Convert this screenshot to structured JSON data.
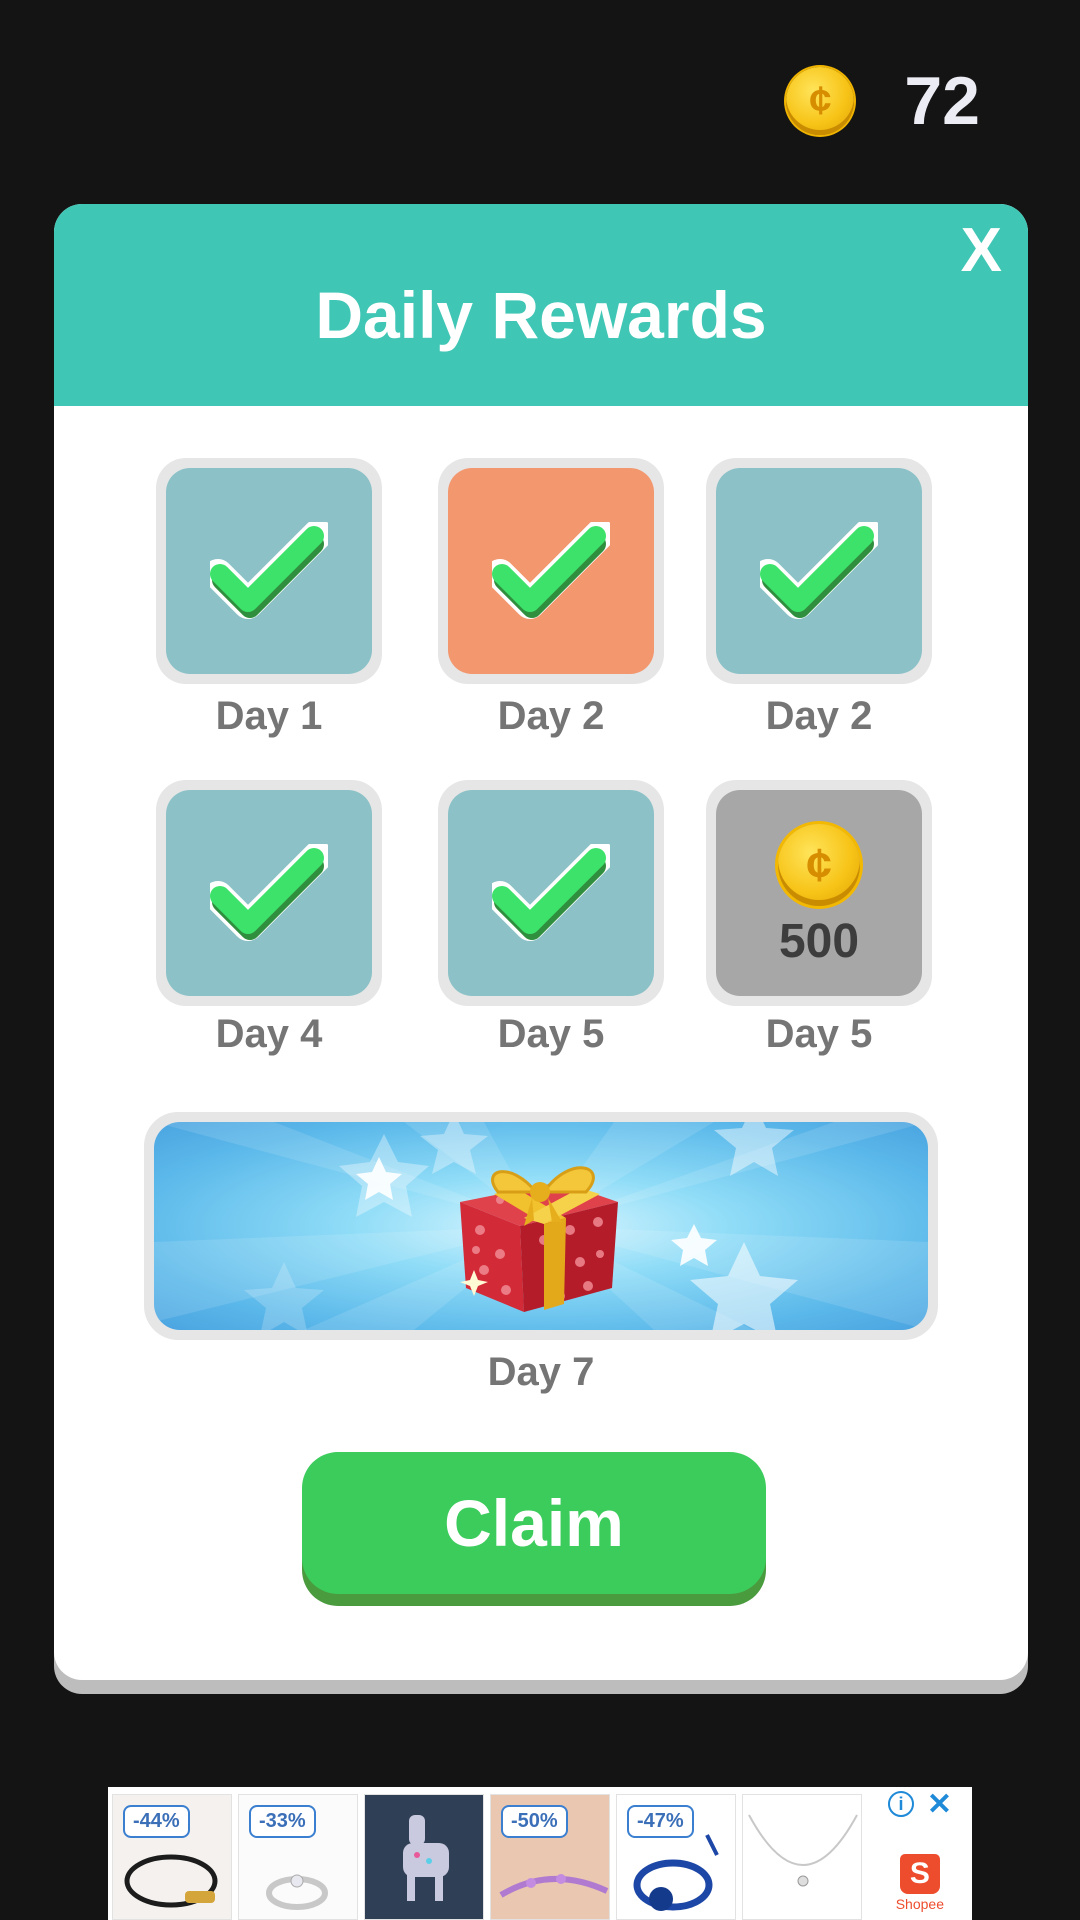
{
  "colors": {
    "background": "#141414",
    "header_teal": "#40c6b5",
    "claim_green": "#3ccc5c",
    "claimed_tile": "#8cc2c7",
    "current_tile": "#f3976e",
    "pending_tile": "#a8a7a8"
  },
  "header": {
    "coin_icon": "coin-icon",
    "coin_count": "72"
  },
  "modal": {
    "title": "Daily Rewards",
    "close_label": "X",
    "rewards": [
      {
        "label": "Day 1",
        "state": "claimed",
        "icon": "check-icon"
      },
      {
        "label": "Day 2",
        "state": "current",
        "icon": "check-icon"
      },
      {
        "label": "Day 2",
        "state": "claimed",
        "icon": "check-icon"
      },
      {
        "label": "Day 4",
        "state": "claimed",
        "icon": "check-icon"
      },
      {
        "label": "Day 5",
        "state": "claimed",
        "icon": "check-icon"
      },
      {
        "label": "Day 5",
        "state": "pending",
        "icon": "coin-icon",
        "amount": "500"
      }
    ],
    "big_reward": {
      "label": "Day 7",
      "icon": "gift-icon"
    },
    "claim_label": "Claim"
  },
  "ad": {
    "items": [
      {
        "discount": "-44%",
        "product": "bracelet"
      },
      {
        "discount": "-33%",
        "product": "ring"
      },
      {
        "discount": "",
        "product": "pin"
      },
      {
        "discount": "-50%",
        "product": "bracelet"
      },
      {
        "discount": "-47%",
        "product": "bracelet"
      },
      {
        "discount": "",
        "product": "necklace"
      }
    ],
    "info_icon": "info-icon",
    "close_icon": "close-icon",
    "brand": "Shopee"
  }
}
